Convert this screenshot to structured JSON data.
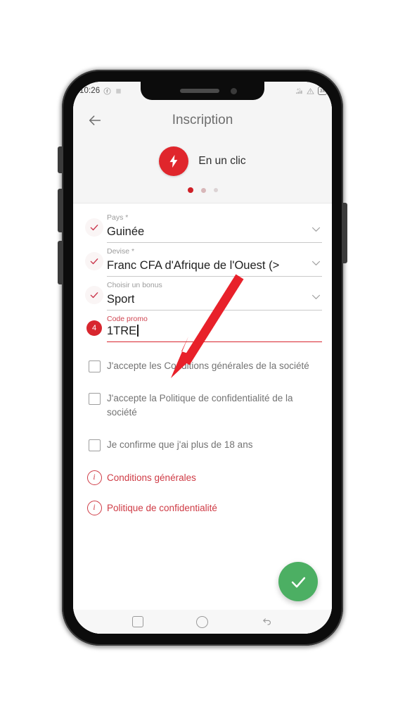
{
  "status_bar": {
    "time": "10:26",
    "left_icons": [
      "facebook-icon",
      "app-icon"
    ],
    "right_icons": [
      "signal-icon",
      "warning-triangle-icon"
    ],
    "battery_label": "3x"
  },
  "app_bar": {
    "back_icon": "arrow-left-icon",
    "title": "Inscription"
  },
  "promo_header": {
    "logo_icon": "lightning-bolt-icon",
    "text": "En un clic",
    "dots": [
      {
        "state": "active"
      },
      {
        "state": "inactive"
      },
      {
        "state": "faint"
      }
    ]
  },
  "form": {
    "fields": [
      {
        "lead": "check",
        "label": "Pays *",
        "value": "Guinée",
        "chevron": "chevron-down-icon",
        "active": false
      },
      {
        "lead": "check",
        "label": "Devise *",
        "value": "Franc CFA d'Afrique de l'Ouest (>",
        "chevron": "chevron-down-icon",
        "active": false
      },
      {
        "lead": "check",
        "label": "Choisir un bonus",
        "value": "Sport",
        "chevron": "chevron-down-icon",
        "active": false
      },
      {
        "lead": "badge",
        "badge": "4",
        "label": "Code promo",
        "value": "1TRE",
        "chevron": "none",
        "active": true
      }
    ],
    "checkboxes": [
      {
        "checked": false,
        "text": "J'accepte les Conditions générales de la société"
      },
      {
        "checked": false,
        "text": "J'accepte la Politique de confidentialité de la société"
      },
      {
        "checked": false,
        "text": "Je confirme que j'ai plus de 18 ans"
      }
    ],
    "links": [
      {
        "icon": "info-icon",
        "glyph": "i",
        "text": "Conditions générales"
      },
      {
        "icon": "info-icon",
        "glyph": "i",
        "text": "Politique de confidentialité"
      }
    ],
    "submit": {
      "icon": "check-icon",
      "color": "#4caf63"
    }
  },
  "nav_bar": {
    "items": [
      {
        "icon": "recents-square-icon"
      },
      {
        "icon": "home-circle-icon"
      },
      {
        "icon": "back-arrow-icon"
      }
    ]
  },
  "annotation": {
    "arrow_color": "#e8212a",
    "target": "code-promo-input"
  },
  "colors": {
    "brand_red": "#d8262e",
    "accent_link": "#cf3b45",
    "submit_green": "#4caf63",
    "header_bg": "#f5f5f5"
  }
}
